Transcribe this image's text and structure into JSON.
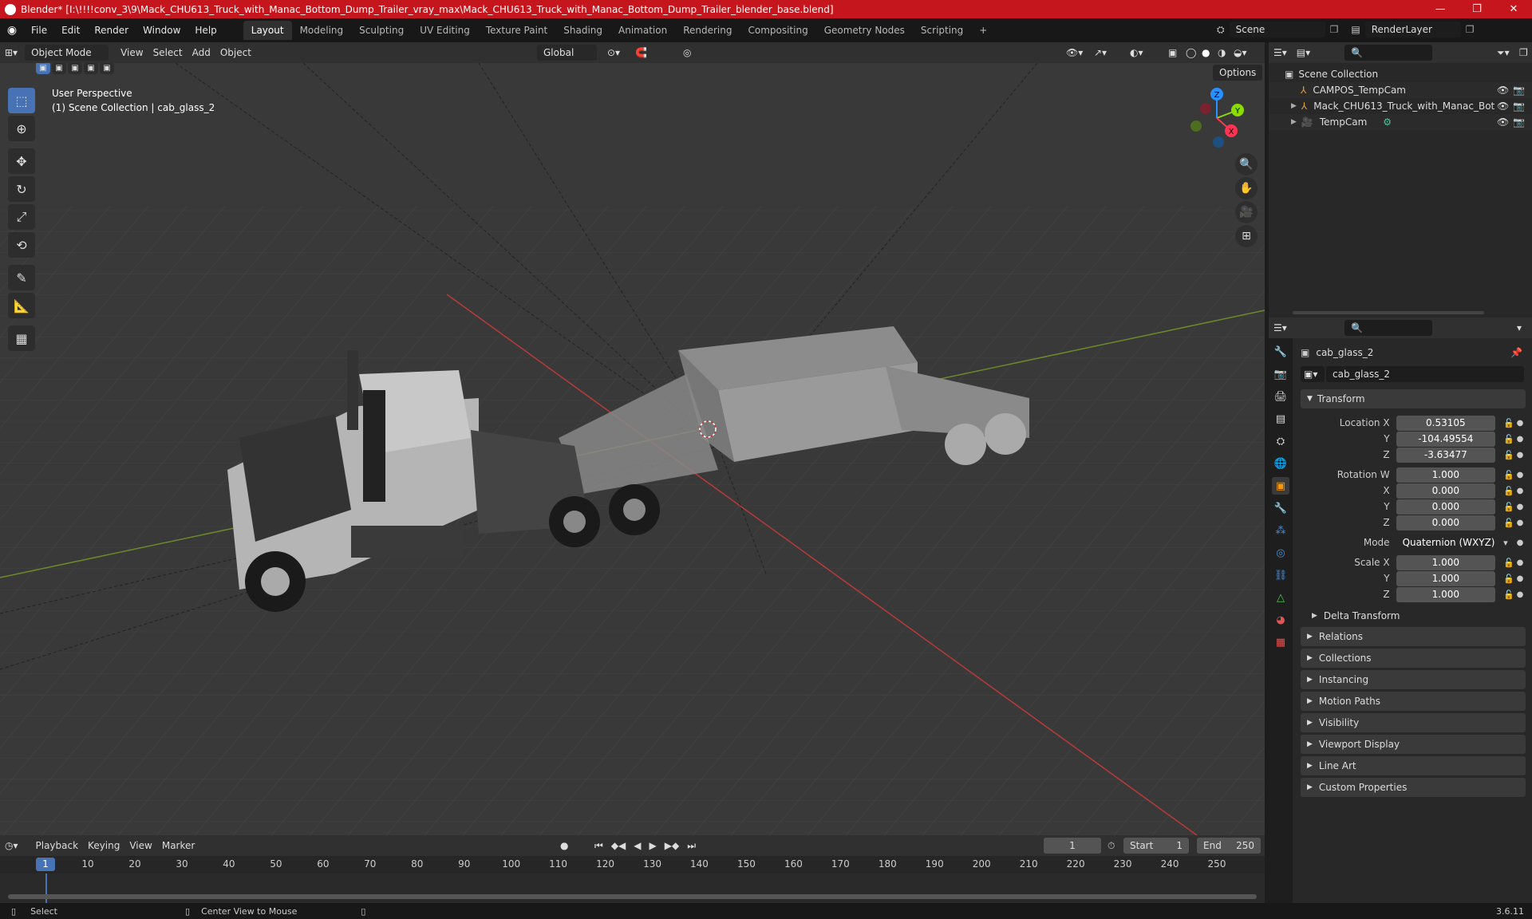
{
  "titlebar": {
    "title": "Blender* [I:\\!!!!conv_3\\9\\Mack_CHU613_Truck_with_Manac_Bottom_Dump_Trailer_vray_max\\Mack_CHU613_Truck_with_Manac_Bottom_Dump_Trailer_blender_base.blend]",
    "minimize": "—",
    "maximize": "❐",
    "close": "✕"
  },
  "menu": [
    "File",
    "Edit",
    "Render",
    "Window",
    "Help"
  ],
  "workspaces": [
    "Layout",
    "Modeling",
    "Sculpting",
    "UV Editing",
    "Texture Paint",
    "Shading",
    "Animation",
    "Rendering",
    "Compositing",
    "Geometry Nodes",
    "Scripting",
    "+"
  ],
  "scene": {
    "name": "Scene",
    "render_layer": "RenderLayer"
  },
  "viewport_header": {
    "mode": "Object Mode",
    "menus": [
      "View",
      "Select",
      "Add",
      "Object"
    ],
    "orientation": "Global",
    "options": "Options"
  },
  "viewport_info": {
    "line1": "User Perspective",
    "line2": "(1) Scene Collection | cab_glass_2"
  },
  "gizmo": {
    "x": "X",
    "y": "Y",
    "z": "Z"
  },
  "outliner": {
    "root": "Scene Collection",
    "items": [
      {
        "name": "CAMPOS_TempCam",
        "icon": "armature-icon"
      },
      {
        "name": "Mack_CHU613_Truck_with_Manac_Bot",
        "icon": "armature-icon"
      },
      {
        "name": "TempCam",
        "icon": "camera-icon"
      }
    ]
  },
  "properties": {
    "object_name": "cab_glass_2",
    "data_name": "cab_glass_2",
    "transform_label": "Transform",
    "location": {
      "label": "Location X",
      "x": "0.53105",
      "y": "-104.49554",
      "z": "-3.63477"
    },
    "rotation": {
      "label": "Rotation W",
      "w": "1.000",
      "x": "0.000",
      "y": "0.000",
      "z": "0.000"
    },
    "mode": {
      "label": "Mode",
      "value": "Quaternion (WXYZ)"
    },
    "scale": {
      "label": "Scale X",
      "x": "1.000",
      "y": "1.000",
      "z": "1.000"
    },
    "axis_labels": {
      "x": "X",
      "y": "Y",
      "z": "Z"
    },
    "delta_transform": "Delta Transform",
    "panels": [
      "Relations",
      "Collections",
      "Instancing",
      "Motion Paths",
      "Visibility",
      "Viewport Display",
      "Line Art",
      "Custom Properties"
    ]
  },
  "timeline": {
    "menus": [
      "Playback",
      "Keying",
      "View",
      "Marker"
    ],
    "current_frame": "1",
    "start_label": "Start",
    "start": "1",
    "end_label": "End",
    "end": "250",
    "ticks": [
      "1",
      "10",
      "20",
      "30",
      "40",
      "50",
      "60",
      "70",
      "80",
      "90",
      "100",
      "110",
      "120",
      "130",
      "140",
      "150",
      "160",
      "170",
      "180",
      "190",
      "200",
      "210",
      "220",
      "230",
      "240",
      "250"
    ]
  },
  "statusbar": {
    "select": "Select",
    "center_view": "Center View to Mouse",
    "version": "3.6.11"
  },
  "colors": {
    "title_red": "#c4161c",
    "accent_blue": "#4772b3",
    "x_axis": "#ff3352",
    "y_axis": "#8bdc00",
    "z_axis": "#2890ff"
  }
}
